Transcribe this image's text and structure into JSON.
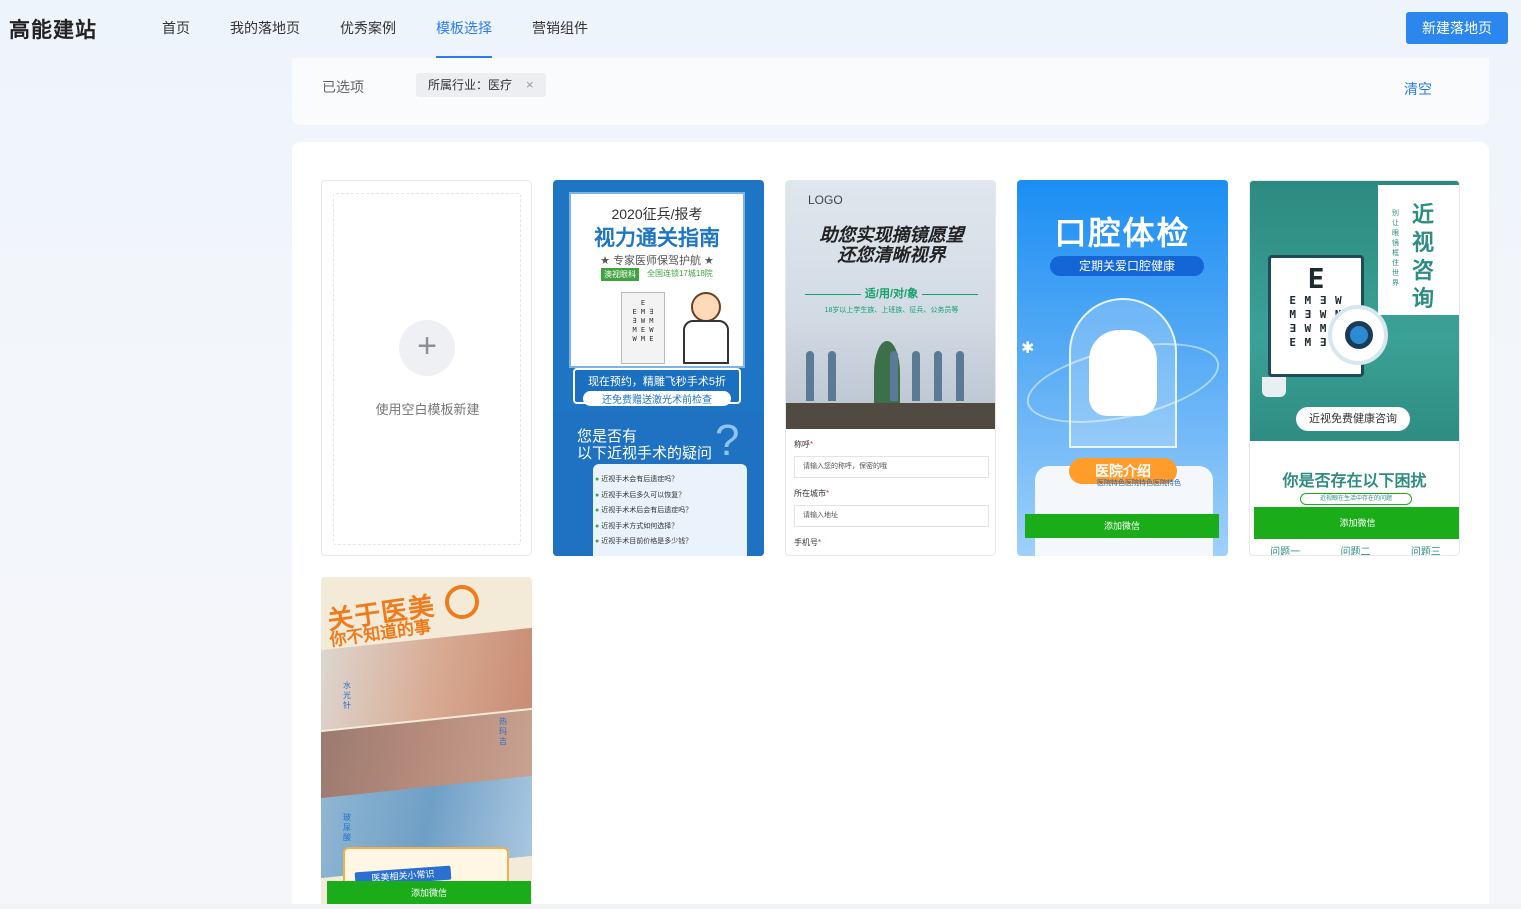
{
  "app": {
    "logo": "高能建站"
  },
  "nav": {
    "items": [
      {
        "label": "首页",
        "active": false
      },
      {
        "label": "我的落地页",
        "active": false
      },
      {
        "label": "优秀案例",
        "active": false
      },
      {
        "label": "模板选择",
        "active": true
      },
      {
        "label": "营销组件",
        "active": false
      }
    ],
    "new_button": "新建落地页"
  },
  "filter": {
    "label": "已选项",
    "tag": "所属行业：医疗",
    "tag_close": "×",
    "clear": "清空"
  },
  "blank_template": {
    "plus": "+",
    "label": "使用空白模板新建"
  },
  "templates": [
    {
      "sub": "2020征兵/报考",
      "title": "视力通关指南",
      "note": "★ 专家医师保驾护航 ★",
      "tag1": "澳视眼科",
      "tag2": "全国连锁17城18院",
      "promo_a": "现在预约，精雕飞秒手术5折",
      "promo_b": "还免费赠送激光术前检查",
      "question": "您是否有\n以下近视手术的疑问",
      "question_mark": "?",
      "questions": [
        "近视手术会有后遗症吗？",
        "近视手术后多久可以恢复？",
        "近视手术术后会有后遗症吗？",
        "近视手术方式如何选择？",
        "近视手术目前价格是多少钱？"
      ]
    },
    {
      "logo": "LOGO",
      "headline": "助您实现摘镜愿望\n还您清晰视界",
      "section": "适/用/对/象",
      "audience": "18岁以上学生族、上班族、征兵、公务员等",
      "fields": [
        {
          "label": "称呼",
          "placeholder": "请输入您的称呼，保密的哦"
        },
        {
          "label": "所在城市",
          "placeholder": "请输入地址"
        },
        {
          "label": "手机号",
          "placeholder": ""
        }
      ],
      "required_mark": "*"
    },
    {
      "title": "口腔体检",
      "slogan": "定期关爱口腔健康",
      "section": "医院介绍",
      "text": "医院特色医院特色医院特色",
      "wechat": "添加微信",
      "star": "✱"
    },
    {
      "vertical_title": "近视咨询",
      "vertical_sub": "别让眼镜框住世界",
      "chart_big": "E",
      "chart_rows": [
        "E M ∃ W",
        "M ∃ W M",
        "∃ W M E",
        "E M ∃ W"
      ],
      "pill": "近视免费健康咨询",
      "question": "你是否存在以下困扰",
      "question_sub": "近视眼在生活中存在的问题",
      "wechat": "添加微信",
      "tabs": [
        "问题一",
        "问题二",
        "问题三"
      ]
    },
    {
      "title_a": "关于医美",
      "title_b": "你不知道的事",
      "side_labels": [
        "水光针",
        "热玛吉",
        "玻尿酸"
      ],
      "tip": "医美相关小常识",
      "wechat": "添加微信"
    }
  ],
  "colors": {
    "accent": "#2b7cf0",
    "button": "#2b86ee",
    "wechat_green": "#1aad19"
  }
}
